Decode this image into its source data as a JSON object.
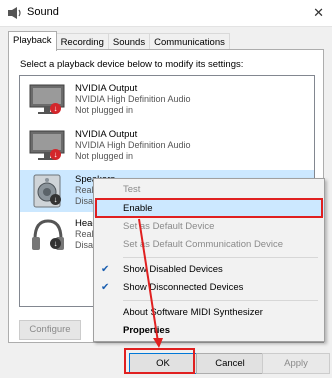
{
  "window": {
    "title": "Sound"
  },
  "tabs": [
    {
      "label": "Playback",
      "active": true
    },
    {
      "label": "Recording"
    },
    {
      "label": "Sounds"
    },
    {
      "label": "Communications"
    }
  ],
  "instruction": "Select a playback device below to modify its settings:",
  "devices": [
    {
      "name": "NVIDIA Output",
      "driver": "NVIDIA High Definition Audio",
      "status": "Not plugged in",
      "icon": "monitor-icon"
    },
    {
      "name": "NVIDIA Output",
      "driver": "NVIDIA High Definition Audio",
      "status": "Not plugged in",
      "icon": "monitor-icon"
    },
    {
      "name": "Speakers",
      "driver": "Realt",
      "status": "Disab",
      "icon": "speaker-icon",
      "selected": true
    },
    {
      "name": "Heac",
      "driver": "Realt",
      "status": "Disal",
      "icon": "headphones-icon"
    }
  ],
  "context_menu": {
    "items": [
      {
        "label": "Test",
        "disabled": true
      },
      {
        "label": "Enable",
        "highlighted": true
      },
      {
        "label": "Set as Default Device",
        "disabled": true
      },
      {
        "label": "Set as Default Communication Device",
        "disabled": true
      },
      {
        "label": "Show Disabled Devices",
        "checked": true
      },
      {
        "label": "Show Disconnected Devices",
        "checked": true
      },
      {
        "label": "About Software MIDI Synthesizer"
      },
      {
        "label": "Properties",
        "bold": true
      }
    ]
  },
  "buttons": {
    "configure": "Configure",
    "ok": "OK",
    "cancel": "Cancel",
    "apply": "Apply"
  },
  "colors": {
    "annotation": "#e02020",
    "selection": "#cce8ff",
    "status_badge": "#d3262b"
  }
}
